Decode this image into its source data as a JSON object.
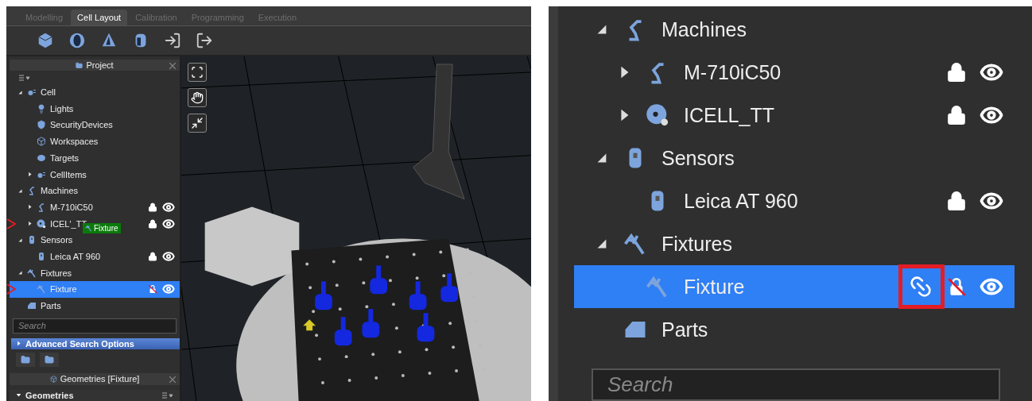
{
  "left_window": {
    "tabs": [
      {
        "label": "Modelling",
        "selected": false
      },
      {
        "label": "Cell Layout",
        "selected": true
      },
      {
        "label": "Calibration",
        "selected": false
      },
      {
        "label": "Programming",
        "selected": false
      },
      {
        "label": "Execution",
        "selected": false
      }
    ],
    "toolbar": [
      {
        "kind": "cube"
      },
      {
        "kind": "sphere"
      },
      {
        "kind": "cone"
      },
      {
        "kind": "cylinder"
      },
      {
        "kind": "import"
      },
      {
        "kind": "export"
      }
    ],
    "project_panel": {
      "title": "Project",
      "tree": [
        {
          "label": "Cell",
          "kind": "cell",
          "expanded": true,
          "children": [
            {
              "label": "Lights",
              "kind": "light"
            },
            {
              "label": "SecurityDevices",
              "kind": "security"
            },
            {
              "label": "Workspaces",
              "kind": "workspace"
            },
            {
              "label": "Targets",
              "kind": "target"
            },
            {
              "label": "CellItems",
              "kind": "cell",
              "expanded": false
            }
          ]
        },
        {
          "label": "Machines",
          "kind": "robot",
          "expanded": true,
          "children": [
            {
              "label": "M-710iC50",
              "kind": "robot",
              "expanded": false,
              "locked": true,
              "visible": true,
              "annotated": false
            },
            {
              "label": "ICEL'_TT",
              "kind": "turntable",
              "expanded": false,
              "locked": true,
              "visible": true,
              "annotated": true,
              "drag_label": "Fixture"
            }
          ]
        },
        {
          "label": "Sensors",
          "kind": "sensor",
          "expanded": true,
          "children": [
            {
              "label": "Leica AT 960",
              "kind": "sensor",
              "locked": true,
              "visible": true,
              "annotated": false
            }
          ]
        },
        {
          "label": "Fixtures",
          "kind": "fixture",
          "expanded": true,
          "children": [
            {
              "label": "Fixture",
              "kind": "fixture",
              "selected": true,
              "locked": false,
              "visible": true,
              "annotated": true
            }
          ]
        },
        {
          "label": "Parts",
          "kind": "part"
        }
      ],
      "search": {
        "placeholder": "Search"
      },
      "advanced": "Advanced Search Options"
    },
    "geometries_panel": {
      "title": "Geometries [Fixture]",
      "section": "Geometries"
    }
  },
  "right_zoom": {
    "tree": [
      {
        "label": "Machines",
        "kind": "robot",
        "expanded": true,
        "children": [
          {
            "label": "M-710iC50",
            "kind": "robot",
            "expanded": false,
            "locked": true,
            "visible": true
          },
          {
            "label": "ICELL_TT",
            "kind": "turntable",
            "expanded": false,
            "locked": true,
            "visible": true
          }
        ]
      },
      {
        "label": "Sensors",
        "kind": "sensor",
        "expanded": true,
        "children": [
          {
            "label": "Leica AT 960",
            "kind": "sensor",
            "locked": true,
            "visible": true
          }
        ]
      },
      {
        "label": "Fixtures",
        "kind": "fixture",
        "expanded": true,
        "children": [
          {
            "label": "Fixture",
            "kind": "fixture",
            "selected": true,
            "link": true,
            "link_highlighted": true,
            "locked": false,
            "visible": true
          }
        ]
      },
      {
        "label": "Parts",
        "kind": "part"
      }
    ],
    "search": {
      "placeholder": "Search"
    }
  }
}
